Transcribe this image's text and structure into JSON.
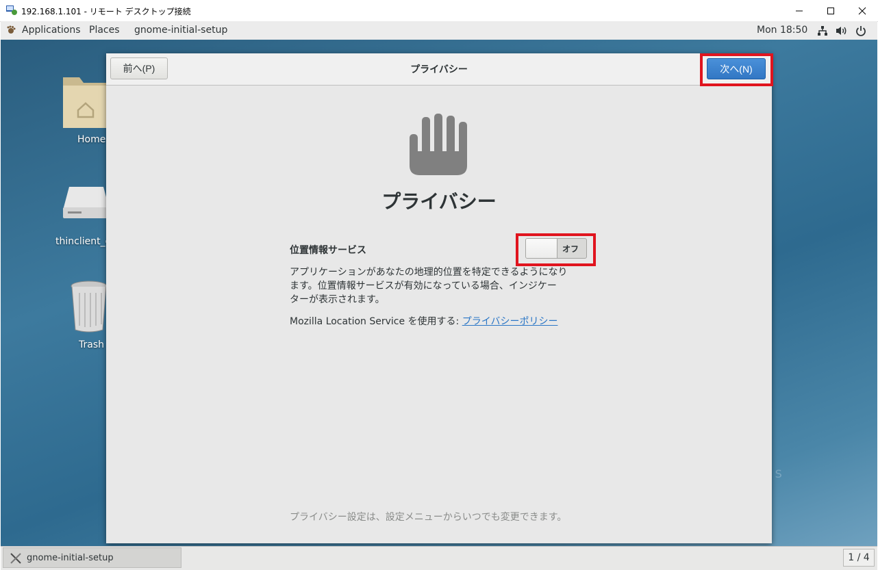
{
  "rdp": {
    "title": "192.168.1.101 - リモート デスクトップ接続",
    "icon": "remote-desktop-icon",
    "controls": [
      "minimize-icon",
      "maximize-icon",
      "close-icon"
    ]
  },
  "panel": {
    "applications": "Applications",
    "places": "Places",
    "app_name": "gnome-initial-setup",
    "clock": "Mon 18:50",
    "status_icons": [
      "network-icon",
      "volume-icon",
      "power-icon"
    ]
  },
  "desktop": {
    "icons": [
      {
        "label": "Home",
        "icon": "home-folder-icon"
      },
      {
        "label": "thinclient_d",
        "icon": "drive-icon"
      },
      {
        "label": "Trash",
        "icon": "trash-icon"
      }
    ],
    "watermark": "OS"
  },
  "dialog": {
    "prev_button": "前へ(P)",
    "title": "プライバシー",
    "next_button": "次へ(N)",
    "icon": "hand-icon",
    "heading": "プライバシー",
    "location": {
      "label": "位置情報サービス",
      "toggle_state": "オフ",
      "toggle_on": false,
      "description_lines": [
        "アプリケーションがあなたの地理的位置を特定できるようになり",
        "ます。位置情報サービスが有効になっている場合、インジケー",
        "ターが表示されます。"
      ]
    },
    "mls_text": "Mozilla Location Service を使用する:",
    "mls_link": "プライバシーポリシー",
    "footer": "プライバシー設定は、設定メニューからいつでも変更できます。"
  },
  "taskbar": {
    "task_label": "gnome-initial-setup",
    "workspace": "1 / 4"
  },
  "colors": {
    "highlight_red": "#e0141e",
    "accent_blue": "#3277c4",
    "link_blue": "#2a76c6"
  }
}
